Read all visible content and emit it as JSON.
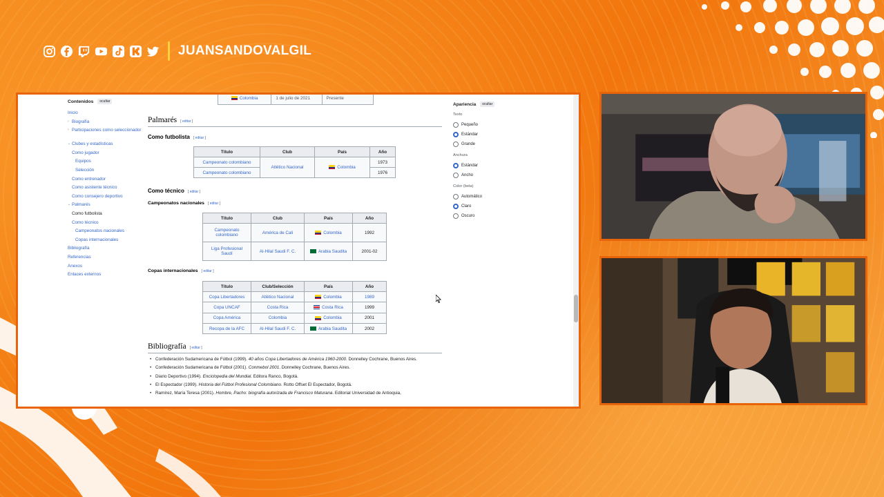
{
  "overlay": {
    "handle": "JUANSANDOVALGIL",
    "social_icons": [
      "instagram-icon",
      "facebook-icon",
      "twitch-icon",
      "youtube-icon",
      "tiktok-icon",
      "kick-icon",
      "twitter-icon"
    ],
    "accent_color": "#f57f12",
    "frame_color": "#e8640a"
  },
  "toc": {
    "title": "Contenidos",
    "hide": "ocultar",
    "items": [
      {
        "label": "Inicio",
        "level": 0
      },
      {
        "label": "Biografía",
        "level": 0,
        "caret": "›"
      },
      {
        "label": "Participaciones como seleccionador",
        "level": 0,
        "caret": "›"
      },
      {
        "label": "Clubes y estadísticas",
        "level": 0,
        "caret": "⌄"
      },
      {
        "label": "Como jugador",
        "level": 1
      },
      {
        "label": "Equipos",
        "level": 2
      },
      {
        "label": "Selección",
        "level": 2
      },
      {
        "label": "Como entrenador",
        "level": 1
      },
      {
        "label": "Como asistente técnico",
        "level": 1
      },
      {
        "label": "Como consejero deportivo",
        "level": 1
      },
      {
        "label": "Palmarés",
        "level": 0,
        "caret": "⌄"
      },
      {
        "label": "Como futbolista",
        "level": 1
      },
      {
        "label": "Como técnico",
        "level": 1
      },
      {
        "label": "Campeonatos nacionales",
        "level": 2
      },
      {
        "label": "Copas internacionales",
        "level": 2
      },
      {
        "label": "Bibliografía",
        "level": 0
      },
      {
        "label": "Referencias",
        "level": 0
      },
      {
        "label": "Anexos",
        "level": 0
      },
      {
        "label": "Enlaces externos",
        "level": 0
      }
    ]
  },
  "top_strip": {
    "country": "Colombia",
    "date": "1 de julio de 2021",
    "until": "Presente"
  },
  "edit_label": "editar",
  "palmares": {
    "title": "Palmarés",
    "futbolista": {
      "title": "Como futbolista",
      "headers": [
        "Título",
        "Club",
        "País",
        "Año"
      ],
      "rows": [
        [
          "Campeonato colombiano",
          "Atlético Nacional",
          "Colombia",
          "1973"
        ],
        [
          "Campeonato colombiano",
          "",
          "",
          "1976"
        ]
      ]
    },
    "tecnico": {
      "title": "Como técnico"
    },
    "nacionales": {
      "title": "Campeonatos nacionales",
      "headers": [
        "Título",
        "Club",
        "País",
        "Año"
      ],
      "rows": [
        [
          "Campeonato colombiano",
          "América de Cali",
          "Colombia",
          "1992"
        ],
        [
          "Liga Profesional Saudí",
          "Al-Hilal Saudi F. C.",
          "Arabia Saudita",
          "2001-02"
        ]
      ]
    },
    "internacionales": {
      "title": "Copas internacionales",
      "headers": [
        "Título",
        "Club/Selección",
        "País",
        "Año"
      ],
      "rows": [
        [
          "Copa Libertadores",
          "Atlético Nacional",
          "Colombia",
          "1989"
        ],
        [
          "Copa UNCAF",
          "Costa Rica",
          "Costa Rica",
          "1999"
        ],
        [
          "Copa América",
          "Colombia",
          "Colombia",
          "2001"
        ],
        [
          "Recopa de la AFC",
          "Al-Hilal Saudi F. C.",
          "Arabia Saudita",
          "2002"
        ]
      ]
    }
  },
  "bibliografia": {
    "title": "Bibliografía",
    "items": [
      {
        "pre": "Confederación Sudamericana de Fútbol (1999). ",
        "em": "40 años Copa Libertadores de América 1960-2000",
        "post": ". Donnelley Cochrane, Buenos Aires."
      },
      {
        "pre": "Confederación Sudamericana de Fútbol (2001). ",
        "em": "Conmebol 2001",
        "post": ". Donnelley Cochrane, Buenos Aires."
      },
      {
        "pre": "Diario Deportivo (1994). ",
        "em": "Enciclopedia del Mundial",
        "post": ". Editora Ranco, Bogotá."
      },
      {
        "pre": "El Espectador (1999). ",
        "em": "Historia del Fútbol Profesional Colombiano",
        "post": ". Rotto Offset El Espectador, Bogotá."
      },
      {
        "pre": "Ramírez, María Teresa (2001). ",
        "em": "Hombre, Pacho: biografía autorizada de Francisco Maturana",
        "post": ". Editorial Universidad de Antioquia,"
      }
    ]
  },
  "appearance": {
    "title": "Apariencia",
    "hide": "ocultar",
    "text_label": "Texto",
    "text_options": [
      "Pequeño",
      "Estándar",
      "Grande"
    ],
    "text_selected": "Estándar",
    "width_label": "Anchura",
    "width_options": [
      "Estándar",
      "Ancho"
    ],
    "width_selected": "Estándar",
    "color_label": "Color (beta)",
    "color_options": [
      "Automático",
      "Claro",
      "Oscuro"
    ],
    "color_selected": "Claro"
  }
}
